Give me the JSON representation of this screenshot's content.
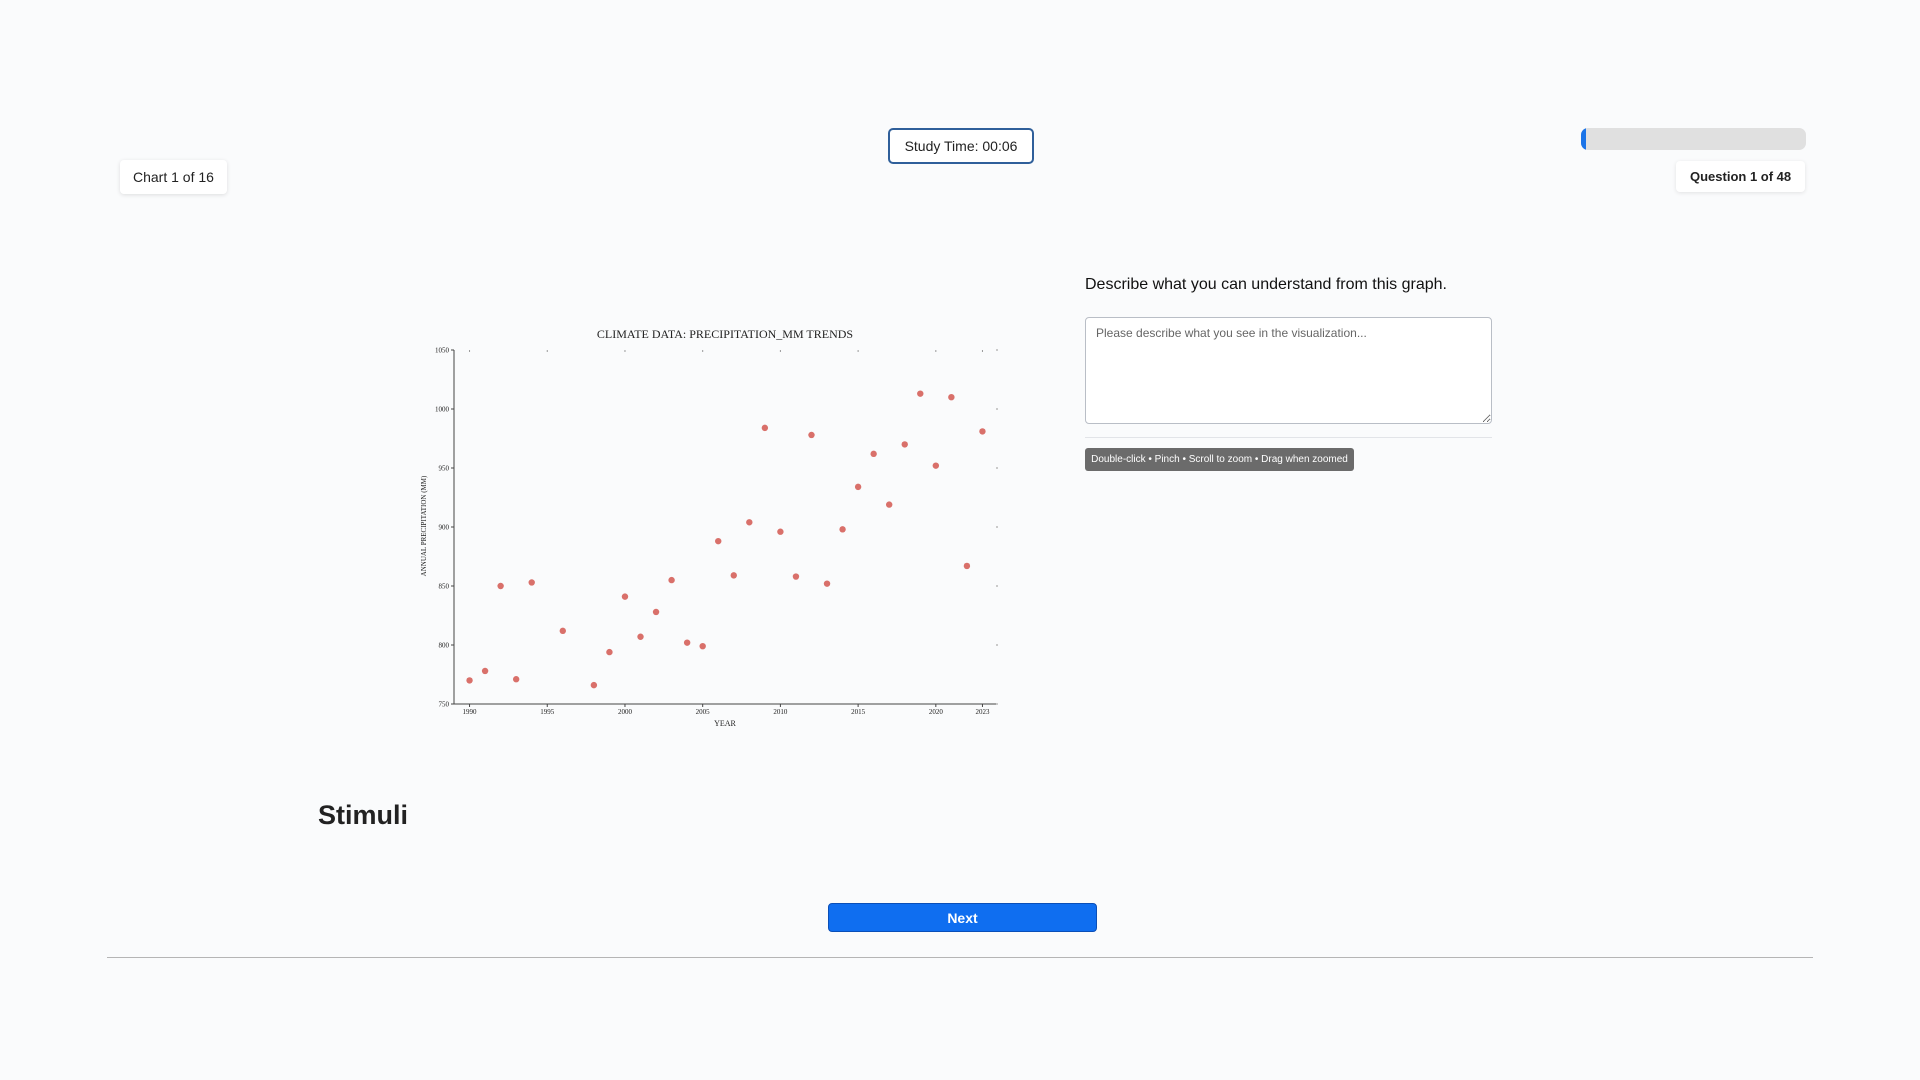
{
  "header": {
    "chart_counter": "Chart 1 of 16",
    "study_time": "Study Time: 00:06",
    "question_counter": "Question 1 of 48",
    "progress_fraction": 0.02,
    "accent_color": "#1b74e8"
  },
  "question": {
    "prompt": "Describe what you can understand from this graph.",
    "placeholder": "Please describe what you see in the visualization...",
    "value": "",
    "zoom_hint": "Double-click • Pinch • Scroll to zoom • Drag when zoomed"
  },
  "section_title": "Stimuli",
  "next_label": "Next",
  "chart_data": {
    "type": "scatter",
    "title": "CLIMATE DATA: PRECIPITATION_MM TRENDS",
    "xlabel": "YEAR",
    "ylabel": "ANNUAL PRECIPITATION (MM)",
    "xlim": [
      1989,
      2024
    ],
    "ylim": [
      750,
      1050
    ],
    "xticks": [
      "1990",
      "1995",
      "2000",
      "2005",
      "2010",
      "2015",
      "2020",
      "2023"
    ],
    "yticks": [
      "750",
      "800",
      "850",
      "900",
      "950",
      "1000",
      "1050"
    ],
    "point_color": "#d9706a",
    "grid": false,
    "x": [
      1990,
      1991,
      1992,
      1993,
      1994,
      1996,
      1998,
      1999,
      2000,
      2001,
      2002,
      2003,
      2004,
      2005,
      2006,
      2007,
      2008,
      2009,
      2010,
      2011,
      2012,
      2013,
      2014,
      2015,
      2016,
      2017,
      2018,
      2019,
      2020,
      2021,
      2022,
      2023
    ],
    "y": [
      770,
      778,
      850,
      771,
      853,
      812,
      766,
      794,
      841,
      807,
      828,
      855,
      802,
      799,
      888,
      859,
      904,
      984,
      896,
      858,
      978,
      852,
      898,
      934,
      962,
      919,
      970,
      1013,
      952,
      1010,
      867,
      981
    ]
  }
}
